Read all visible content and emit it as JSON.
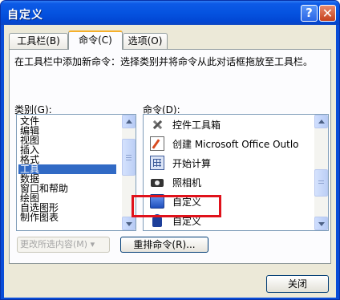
{
  "window": {
    "title": "自定义"
  },
  "titlebar": {
    "help_label": "?",
    "close_label": "✕"
  },
  "tabs": [
    {
      "label": "工具栏(B)"
    },
    {
      "label": "命令(C)"
    },
    {
      "label": "选项(O)"
    }
  ],
  "instruction": "在工具栏中添加新命令：选择类别并将命令从此对话框拖放至工具栏。",
  "categories": {
    "label": "类别(G):",
    "items": [
      "文件",
      "编辑",
      "视图",
      "插入",
      "格式",
      "工具",
      "数据",
      "窗口和帮助",
      "绘图",
      "自选图形",
      "制作图表"
    ],
    "selected": "工具"
  },
  "commands": {
    "label": "命令(D):",
    "items": [
      {
        "label": "控件工具箱",
        "icon": "toolbox-icon"
      },
      {
        "label": "创建 Microsoft Office Outlo",
        "icon": "create-outlook-icon"
      },
      {
        "label": "开始计算",
        "icon": "calculator-icon"
      },
      {
        "label": "照相机",
        "icon": "camera-icon"
      },
      {
        "label": "自定义",
        "icon": "custom-icon"
      },
      {
        "label": "自定义",
        "icon": "custom-icon"
      }
    ],
    "highlighted": "照相机"
  },
  "buttons": {
    "modify_selection": "更改所选内容(M) ▾",
    "rearrange": "重排命令(R)...",
    "close": "关闭"
  },
  "colors": {
    "titlebar": "#0553e0",
    "selection": "#316ac5",
    "highlight_box": "#e0121b",
    "dialog_bg": "#ece9d8"
  }
}
